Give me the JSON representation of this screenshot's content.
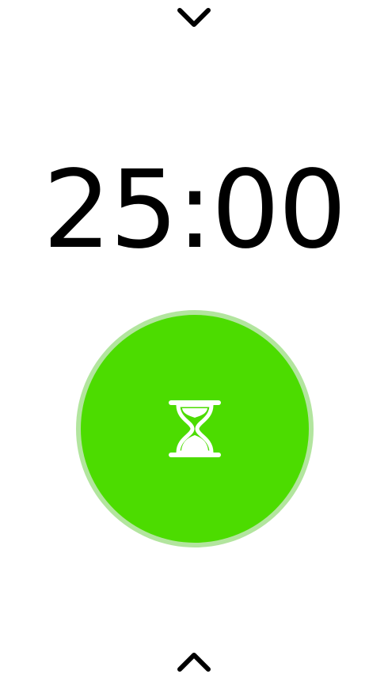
{
  "timer": {
    "display": "25:00"
  },
  "icons": {
    "top": "chevron-down-icon",
    "bottom": "chevron-up-icon",
    "start": "hourglass-icon"
  },
  "colors": {
    "accent": "#4cdc00",
    "accent_ring": "#b2e59e",
    "text": "#000000",
    "background": "#ffffff"
  }
}
